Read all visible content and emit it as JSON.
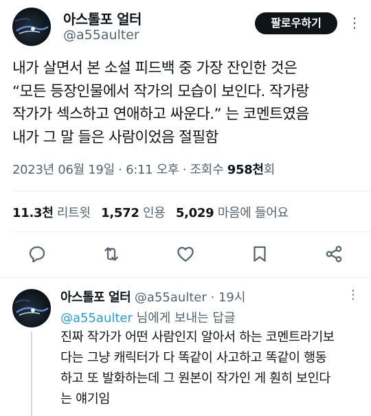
{
  "tweet": {
    "author_name": "아스톨포 얼터",
    "author_handle": "@a55aulter",
    "follow_label": "팔로우하기",
    "more_glyph": "⋮",
    "text": "내가 살면서 본 소설 피드백 중 가장 잔인한 것은\n“모든 등장인물에서 작가의 모습이 보인다. 작가랑\n작가가 섹스하고 연애하고 싸운다.” 는 코멘트였음\n내가 그 말 들은 사람이었음 절필함",
    "date": "2023년 06월 19일",
    "sep1": " · ",
    "time": "6:11 오후",
    "sep2": " · ",
    "views_prefix": "조회수 ",
    "views_value": "958천",
    "views_suffix": "회"
  },
  "stats": {
    "retweets": "11.3천",
    "retweets_label": "리트윗",
    "quotes": "1,572",
    "quotes_label": "인용",
    "likes": "5,029",
    "likes_label": "마음에 들어요"
  },
  "actions": {
    "reply_icon": "reply-icon",
    "retweet_icon": "retweet-icon",
    "like_icon": "heart-icon",
    "bookmark_icon": "bookmark-icon",
    "share_icon": "share-icon"
  },
  "reply": {
    "author_name": "아스톨포 얼터",
    "author_handle": "@a55aulter",
    "dot": " · ",
    "time": "19시",
    "more_glyph": "⋮",
    "replying_mention": "@a55aulter",
    "replying_suffix": " 님에게 보내는 답글",
    "text": "진짜 작가가 어떤 사람인지 알아서 하는 코멘트라기보\n다는 그냥 캐릭터가 다 똑같이 사고하고 똑같이 행동\n하고 또 발화하는데 그 원본이 작가인 게 훤히 보인다\n는 얘기임"
  },
  "colors": {
    "text": "#0f1419",
    "secondary": "#536471",
    "accent": "#1d9bf0",
    "divider": "#eff3f4"
  }
}
